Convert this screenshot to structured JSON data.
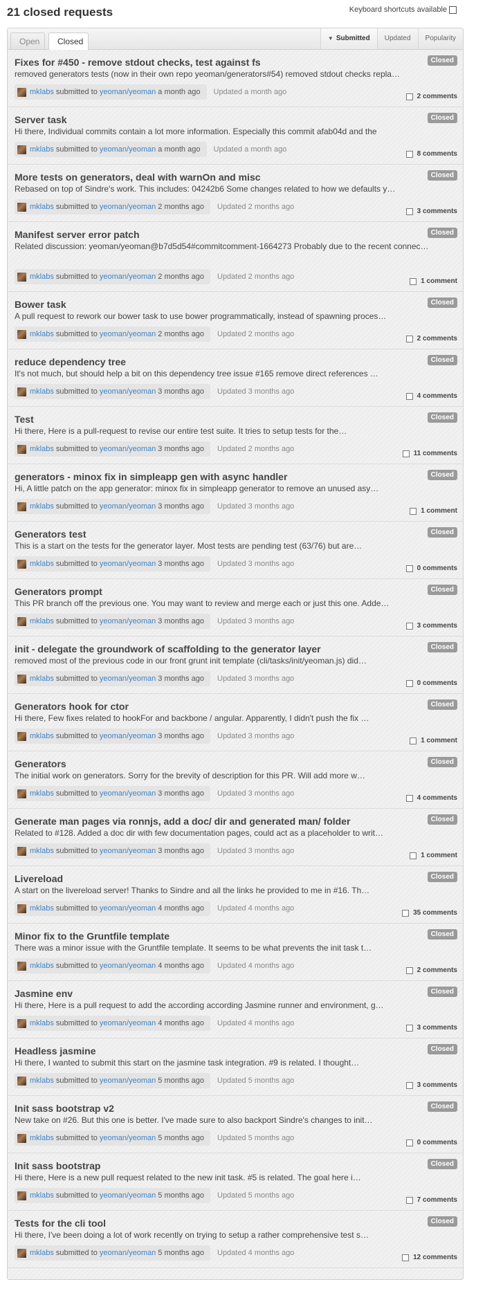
{
  "header": {
    "title": "21 closed requests",
    "keyboard_hint": "Keyboard shortcuts available"
  },
  "tabs": {
    "open": "Open",
    "closed": "Closed"
  },
  "sort": {
    "submitted": "Submitted",
    "updated": "Updated",
    "popularity": "Popularity"
  },
  "labels": {
    "submitted_to": "submitted to"
  },
  "pulls": [
    {
      "title": "Fixes for #450 - remove stdout checks, test against fs",
      "state": "Closed",
      "desc": "removed generators tests (now in their own repo yeoman/generators#54) removed stdout checks repla…",
      "author": "mklabs",
      "repo": "yeoman/yeoman",
      "submitted": "a month ago",
      "updated": "Updated a month ago",
      "comments": "2 comments"
    },
    {
      "title": "Server task",
      "state": "Closed",
      "desc": "Hi there, Individual commits contain a lot more information. Especially this commit afab04d and the",
      "author": "mklabs",
      "repo": "yeoman/yeoman",
      "submitted": "a month ago",
      "updated": "Updated a month ago",
      "comments": "8 comments"
    },
    {
      "title": "More tests on generators, deal with warnOn and misc",
      "state": "Closed",
      "desc": "Rebased on top of Sindre's work. This includes: 04242b6 Some changes related to how we defaults y…",
      "author": "mklabs",
      "repo": "yeoman/yeoman",
      "submitted": "2 months ago",
      "updated": "Updated 2 months ago",
      "comments": "3 comments"
    },
    {
      "title": "Manifest server error patch",
      "state": "Closed",
      "desc": "Related discussion: yeoman/yeoman@b7d5d54#commitcomment-1664273 Probably due to the recent connec…",
      "author": "mklabs",
      "repo": "yeoman/yeoman",
      "submitted": "2 months ago",
      "updated": "Updated 2 months ago",
      "comments": "1 comment",
      "tall": true
    },
    {
      "title": "Bower task",
      "state": "Closed",
      "desc": "A pull request to rework our bower task to use bower programmatically, instead of spawning proces…",
      "author": "mklabs",
      "repo": "yeoman/yeoman",
      "submitted": "2 months ago",
      "updated": "Updated 2 months ago",
      "comments": "2 comments"
    },
    {
      "title": "reduce dependency tree",
      "state": "Closed",
      "desc": "It's not much, but should help a bit on this dependency tree issue #165 remove direct references …",
      "author": "mklabs",
      "repo": "yeoman/yeoman",
      "submitted": "3 months ago",
      "updated": "Updated 3 months ago",
      "comments": "4 comments"
    },
    {
      "title": "Test",
      "state": "Closed",
      "desc": "Hi there, Here is a pull-request to revise our entire test suite. It tries to setup tests for the…",
      "author": "mklabs",
      "repo": "yeoman/yeoman",
      "submitted": "3 months ago",
      "updated": "Updated 2 months ago",
      "comments": "11 comments"
    },
    {
      "title": "generators - minox fix in simpleapp gen with async handler",
      "state": "Closed",
      "desc": "Hi, A little patch on the app generator: minox fix in simpleapp generator to remove an unused asy…",
      "author": "mklabs",
      "repo": "yeoman/yeoman",
      "submitted": "3 months ago",
      "updated": "Updated 3 months ago",
      "comments": "1 comment"
    },
    {
      "title": "Generators test",
      "state": "Closed",
      "desc": "This is a start on the tests for the generator layer. Most tests are pending test (63/76) but are…",
      "author": "mklabs",
      "repo": "yeoman/yeoman",
      "submitted": "3 months ago",
      "updated": "Updated 3 months ago",
      "comments": "0 comments"
    },
    {
      "title": "Generators prompt",
      "state": "Closed",
      "desc": "This PR branch off the previous one. You may want to review and merge each or just this one. Adde…",
      "author": "mklabs",
      "repo": "yeoman/yeoman",
      "submitted": "3 months ago",
      "updated": "Updated 3 months ago",
      "comments": "3 comments"
    },
    {
      "title": "init - delegate the groundwork of scaffolding to the generator layer",
      "state": "Closed",
      "desc": "removed most of the previous code in our front grunt init template (cli/tasks/init/yeoman.js) did…",
      "author": "mklabs",
      "repo": "yeoman/yeoman",
      "submitted": "3 months ago",
      "updated": "Updated 3 months ago",
      "comments": "0 comments"
    },
    {
      "title": "Generators hook for ctor",
      "state": "Closed",
      "desc": "Hi there, Few fixes related to hookFor and backbone / angular. Apparently, I didn't push the fix …",
      "author": "mklabs",
      "repo": "yeoman/yeoman",
      "submitted": "3 months ago",
      "updated": "Updated 3 months ago",
      "comments": "1 comment"
    },
    {
      "title": "Generators",
      "state": "Closed",
      "desc": "The initial work on generators. Sorry for the brevity of description for this PR. Will add more w…",
      "author": "mklabs",
      "repo": "yeoman/yeoman",
      "submitted": "3 months ago",
      "updated": "Updated 3 months ago",
      "comments": "4 comments"
    },
    {
      "title": "Generate man pages via ronnjs, add a doc/ dir and generated man/ folder",
      "state": "Closed",
      "desc": "Related to #128. Added a doc dir with few documentation pages, could act as a placeholder to writ…",
      "author": "mklabs",
      "repo": "yeoman/yeoman",
      "submitted": "3 months ago",
      "updated": "Updated 3 months ago",
      "comments": "1 comment"
    },
    {
      "title": "Livereload",
      "state": "Closed",
      "desc": "A start on the livereload server! Thanks to Sindre and all the links he provided to me in #16. Th…",
      "author": "mklabs",
      "repo": "yeoman/yeoman",
      "submitted": "4 months ago",
      "updated": "Updated 4 months ago",
      "comments": "35 comments"
    },
    {
      "title": "Minor fix to the Gruntfile template",
      "state": "Closed",
      "desc": "There was a minor issue with the Gruntfile template. It seems to be what prevents the init task t…",
      "author": "mklabs",
      "repo": "yeoman/yeoman",
      "submitted": "4 months ago",
      "updated": "Updated 4 months ago",
      "comments": "2 comments"
    },
    {
      "title": "Jasmine env",
      "state": "Closed",
      "desc": "Hi there, Here is a pull request to add the according according Jasmine runner and environment, g…",
      "author": "mklabs",
      "repo": "yeoman/yeoman",
      "submitted": "4 months ago",
      "updated": "Updated 4 months ago",
      "comments": "3 comments"
    },
    {
      "title": "Headless jasmine",
      "state": "Closed",
      "desc": "Hi there, I wanted to submit this start on the jasmine task integration. #9 is related. I thought…",
      "author": "mklabs",
      "repo": "yeoman/yeoman",
      "submitted": "5 months ago",
      "updated": "Updated 5 months ago",
      "comments": "3 comments"
    },
    {
      "title": "Init sass bootstrap v2",
      "state": "Closed",
      "desc": "New take on #26. But this one is better. I've made sure to also backport Sindre's changes to init…",
      "author": "mklabs",
      "repo": "yeoman/yeoman",
      "submitted": "5 months ago",
      "updated": "Updated 5 months ago",
      "comments": "0 comments"
    },
    {
      "title": "Init sass bootstrap",
      "state": "Closed",
      "desc": "Hi there, Here is a new pull request related to the new init task. #5 is related. The goal here i…",
      "author": "mklabs",
      "repo": "yeoman/yeoman",
      "submitted": "5 months ago",
      "updated": "Updated 5 months ago",
      "comments": "7 comments"
    },
    {
      "title": "Tests for the cli tool",
      "state": "Closed",
      "desc": "Hi there, I've been doing a lot of work recently on trying to setup a rather comprehensive test s…",
      "author": "mklabs",
      "repo": "yeoman/yeoman",
      "submitted": "5 months ago",
      "updated": "Updated 4 months ago",
      "comments": "12 comments"
    }
  ]
}
